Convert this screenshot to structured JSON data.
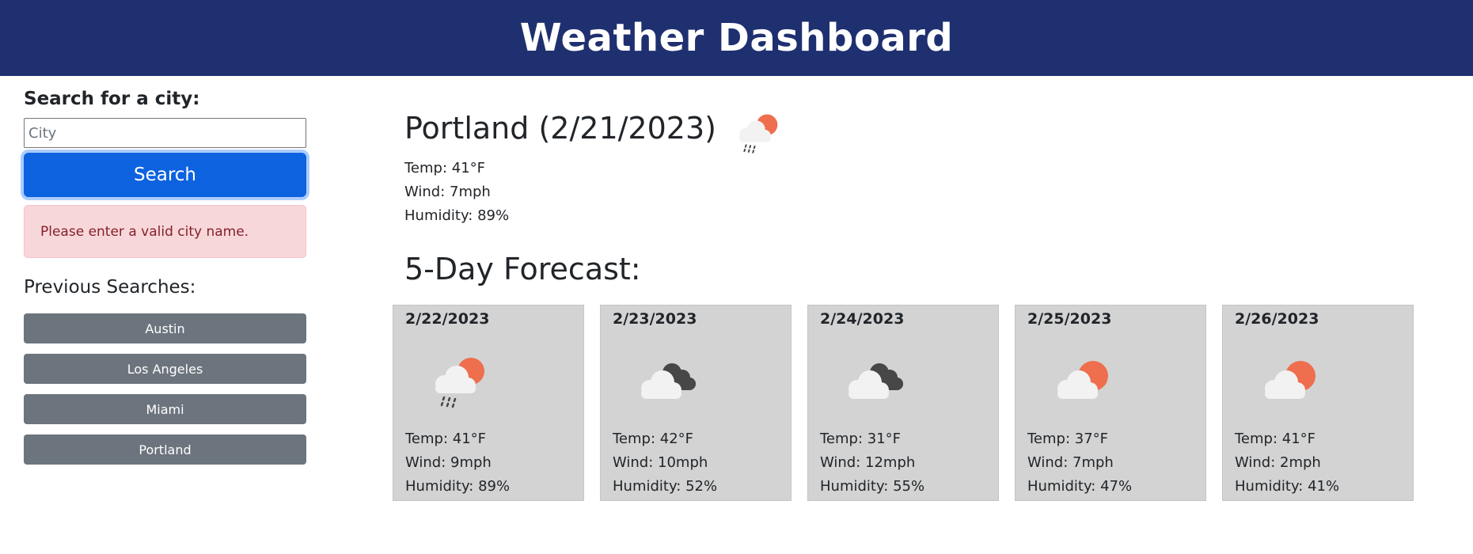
{
  "header": {
    "title": "Weather Dashboard"
  },
  "sidebar": {
    "search_label": "Search for a city:",
    "input_placeholder": "City",
    "input_value": "",
    "search_button": "Search",
    "alert_text": "Please enter a valid city name.",
    "previous_label": "Previous Searches:",
    "history": [
      "Austin",
      "Los Angeles",
      "Miami",
      "Portland"
    ]
  },
  "current": {
    "title": "Portland (2/21/2023)",
    "icon": "partly-sunny-rain-icon",
    "temp": "Temp: 41°F",
    "wind": "Wind: 7mph",
    "humidity": "Humidity: 89%"
  },
  "forecast": {
    "title": "5-Day Forecast:",
    "days": [
      {
        "date": "2/22/2023",
        "icon": "partly-sunny-rain-icon",
        "temp": "Temp: 41°F",
        "wind": "Wind: 9mph",
        "humidity": "Humidity: 89%"
      },
      {
        "date": "2/23/2023",
        "icon": "broken-clouds-icon",
        "temp": "Temp: 42°F",
        "wind": "Wind: 10mph",
        "humidity": "Humidity: 52%"
      },
      {
        "date": "2/24/2023",
        "icon": "broken-clouds-icon",
        "temp": "Temp: 31°F",
        "wind": "Wind: 12mph",
        "humidity": "Humidity: 55%"
      },
      {
        "date": "2/25/2023",
        "icon": "partly-cloudy-icon",
        "temp": "Temp: 37°F",
        "wind": "Wind: 7mph",
        "humidity": "Humidity: 47%"
      },
      {
        "date": "2/26/2023",
        "icon": "partly-cloudy-icon",
        "temp": "Temp: 41°F",
        "wind": "Wind: 2mph",
        "humidity": "Humidity: 41%"
      }
    ]
  },
  "colors": {
    "header_bg": "#1f3070",
    "search_button": "#0d62e0",
    "alert_bg": "#f8d7da",
    "alert_text": "#842029",
    "history_button": "#6c757d",
    "card_bg": "#d3d3d3",
    "sun": "#ee6e4e"
  }
}
